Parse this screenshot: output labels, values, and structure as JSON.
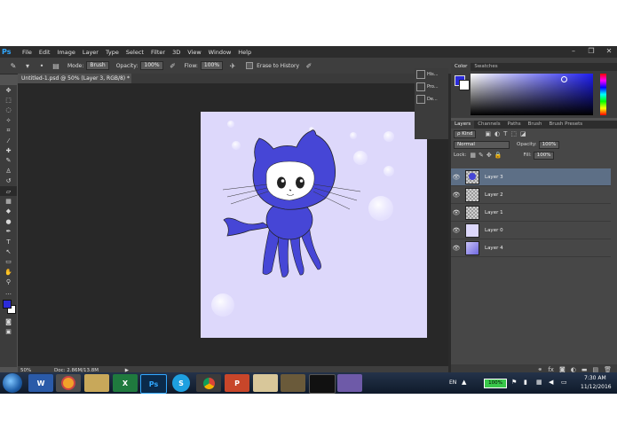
{
  "app": {
    "logo": "Ps"
  },
  "menu": [
    "File",
    "Edit",
    "Image",
    "Layer",
    "Type",
    "Select",
    "Filter",
    "3D",
    "View",
    "Window",
    "Help"
  ],
  "options": {
    "mode_label": "Mode:",
    "mode_value": "Brush",
    "opacity_label": "Opacity:",
    "opacity_value": "100%",
    "flow_label": "Flow:",
    "flow_value": "100%",
    "erase_history_label": "Erase to History"
  },
  "document": {
    "tab_title": "Untitled-1.psd @ 50% (Layer 3, RGB/8) *",
    "close_glyph": "×"
  },
  "status": {
    "zoom": "50%",
    "doc_info": "Doc: 2.86M/13.8M"
  },
  "mini_panel": [
    "His...",
    "Pro...",
    "De..."
  ],
  "color_panel": {
    "tabs": [
      "Color",
      "Swatches"
    ]
  },
  "layers_panel": {
    "tabs": [
      "Layers",
      "Channels",
      "Paths",
      "Brush",
      "Brush Presets"
    ],
    "filter_kind": "ρ Kind",
    "blend_mode": "Normal",
    "opacity_label": "Opacity:",
    "opacity_value": "100%",
    "lock_label": "Lock:",
    "fill_label": "Fill:",
    "fill_value": "100%",
    "layers": [
      {
        "name": "Layer 3",
        "selected": true
      },
      {
        "name": "Layer 2",
        "selected": false
      },
      {
        "name": "Layer 1",
        "selected": false
      },
      {
        "name": "Layer 0",
        "selected": false
      },
      {
        "name": "Layer 4",
        "selected": false
      }
    ]
  },
  "taskbar": {
    "apps": [
      "W",
      "",
      "",
      "X",
      "Ps",
      "S",
      "",
      "P",
      "",
      "",
      "",
      ""
    ],
    "lang": "EN",
    "battery": "100%",
    "time": "7:30 AM",
    "date": "11/12/2016"
  },
  "colors": {
    "foreground": "#2b2bd9",
    "background": "#ffffff",
    "artboard_bg": "#ddd8fb",
    "character": "#4646d6"
  }
}
